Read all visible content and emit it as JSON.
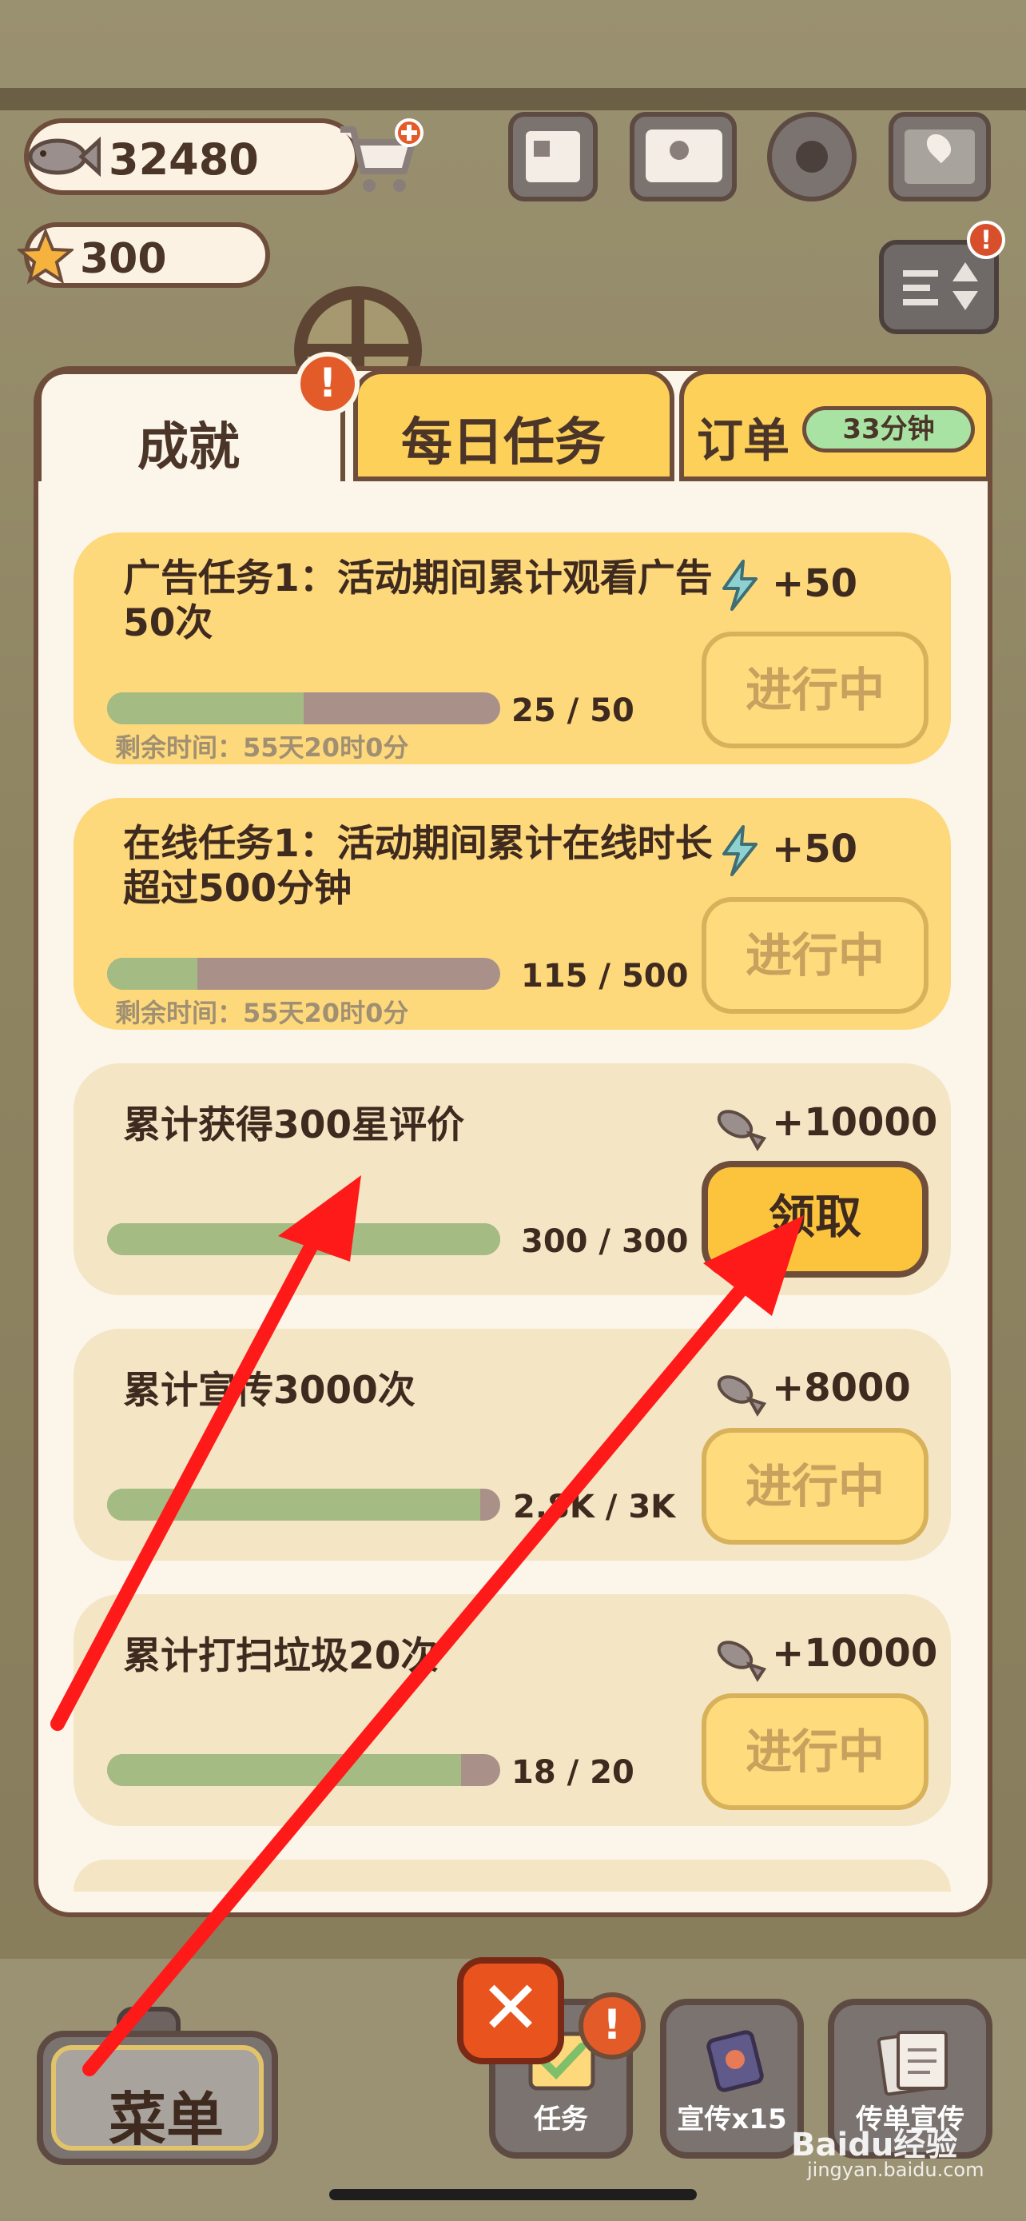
{
  "hud": {
    "fish_count": "32480",
    "star_count": "300"
  },
  "tabs": {
    "achievements": "成就",
    "daily": "每日任务",
    "order": "订单",
    "order_timer": "33分钟",
    "badge": "!"
  },
  "cards": [
    {
      "title": "广告任务1：活动期间累计观看广告50次",
      "reward": "+50",
      "reward_icon": "energy-icon",
      "progress_text": "25  /  50",
      "progress": 0.5,
      "remaining": "剩余时间：55天20时0分",
      "button": "进行中",
      "button_state": "in-progress"
    },
    {
      "title": "在线任务1：活动期间累计在线时长超过500分钟",
      "reward": "+50",
      "reward_icon": "energy-icon",
      "progress_text": "115 / 500",
      "progress": 0.23,
      "remaining": "剩余时间：55天20时0分",
      "button": "进行中",
      "button_state": "in-progress"
    },
    {
      "title": "累计获得300星评价",
      "reward": "+10000",
      "reward_icon": "fish-icon",
      "progress_text": "300 / 300",
      "progress": 1.0,
      "button": "领取",
      "button_state": "claim"
    },
    {
      "title": "累计宣传3000次",
      "reward": "+8000",
      "reward_icon": "fish-icon",
      "progress_text": "2.8K /  3K",
      "progress": 0.95,
      "button": "进行中",
      "button_state": "in-progress"
    },
    {
      "title": "累计打扫垃圾20次",
      "reward": "+10000",
      "reward_icon": "fish-icon",
      "progress_text": "18  /  20",
      "progress": 0.9,
      "button": "进行中",
      "button_state": "in-progress"
    }
  ],
  "bottom": {
    "menu": "菜单",
    "close": "✕",
    "task": "任务",
    "promote": "宣传x15",
    "flyer": "传单宣传",
    "task_badge": "!"
  },
  "watermark": {
    "brand": "Baidu经验",
    "url": "jingyan.baidu.com"
  },
  "colors": {
    "panel": "#fbf5ea",
    "card_yellow": "#fdd97c",
    "card_beige": "#f4e6c4",
    "progress_fill": "#a4bc84",
    "claim_button": "#fcc43c",
    "arrow": "#ff1a1a"
  }
}
